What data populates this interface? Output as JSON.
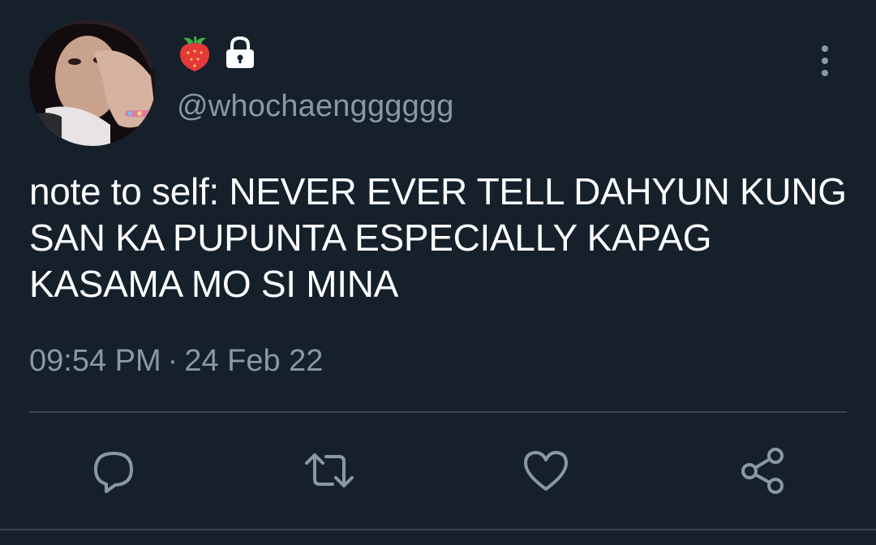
{
  "tweet": {
    "avatar_alt": "profile photo",
    "name_icons": [
      "strawberry-icon",
      "lock-icon"
    ],
    "handle": "@whochaengggggg",
    "text": "note to self: NEVER EVER TELL DAHYUN KUNG SAN KA PUPUNTA ESPECIALLY KAPAG KASAMA MO SI MINA",
    "time": "09:54 PM",
    "separator": "·",
    "date": "24 Feb 22"
  },
  "actions": [
    {
      "icon": "reply-icon"
    },
    {
      "icon": "retweet-icon"
    },
    {
      "icon": "like-icon"
    },
    {
      "icon": "share-icon"
    }
  ],
  "colors": {
    "background": "#15202b",
    "primary_text": "#ffffff",
    "secondary_text": "#8899a6",
    "divider": "#38444d"
  }
}
